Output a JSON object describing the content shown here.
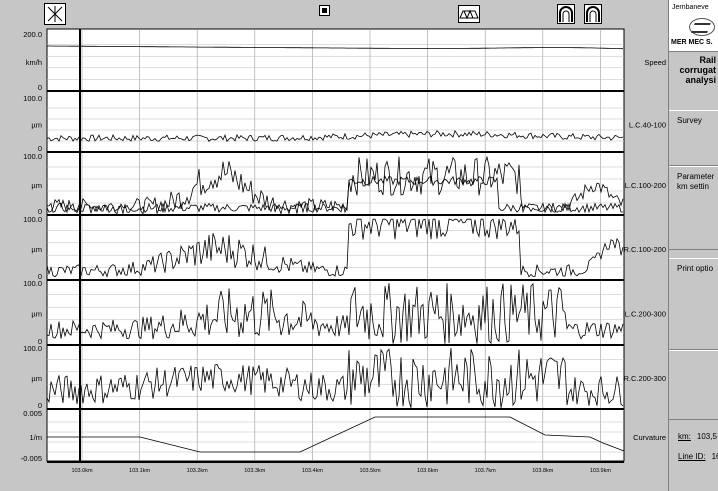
{
  "toolbar": {
    "buttons": [
      {
        "name": "survey-mark-icon"
      },
      {
        "name": "small-marker-icon"
      },
      {
        "name": "bridge-icon"
      },
      {
        "name": "tunnel-left-icon"
      },
      {
        "name": "tunnel-right-icon"
      }
    ]
  },
  "panels": [
    {
      "label": "Speed",
      "unit": "km/h",
      "top": "200.0",
      "bottom": "0"
    },
    {
      "label": "L.C.40-100",
      "unit": "µm",
      "top": "100.0",
      "bottom": "0"
    },
    {
      "label": "L.C.100-200",
      "unit": "µm",
      "top": "100.0",
      "bottom": "0"
    },
    {
      "label": "R.C.100-200",
      "unit": "µm",
      "top": "100.0",
      "bottom": "0"
    },
    {
      "label": "L.C.200-300",
      "unit": "µm",
      "top": "100.0",
      "bottom": "0"
    },
    {
      "label": "R.C.200-300",
      "unit": "µm",
      "top": "100.0",
      "bottom": "0"
    },
    {
      "label": "Curvature",
      "unit": "1/m",
      "top": "0.005",
      "bottom": "-0.005"
    }
  ],
  "x_ticks": [
    "103.0km",
    "103.1km",
    "103.2km",
    "103.3km",
    "103.4km",
    "103.5km",
    "103.6km",
    "103.7km",
    "103.8km",
    "103.9km"
  ],
  "sidebar": {
    "company": "Jernbaneve",
    "logo_text": "MER MEC S.",
    "title_lines": [
      "Rail",
      "corrugat",
      "analysi"
    ],
    "buttons": [
      "Survey",
      "Parameter\nkm settin",
      "Print optio"
    ],
    "km_label": "km:",
    "km_value": "103,5",
    "line_label": "Line ID:",
    "line_value": "16"
  },
  "colors": {
    "background": "#c6c6c6",
    "plot": "#ffffff",
    "trace": "#000000"
  }
}
